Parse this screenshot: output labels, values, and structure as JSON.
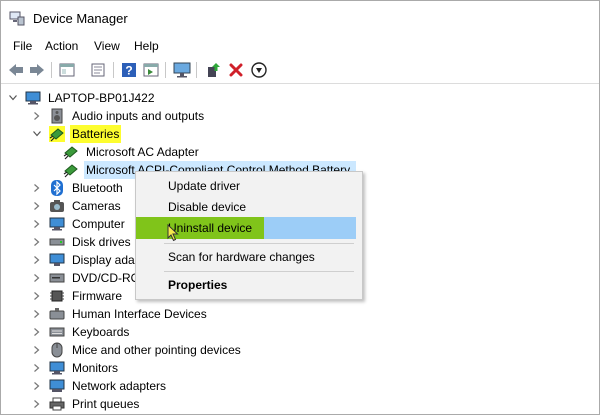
{
  "window": {
    "title": "Device Manager"
  },
  "menu": [
    "File",
    "Action",
    "View",
    "Help"
  ],
  "toolbar": [
    "back-icon",
    "forward-icon",
    "properties-icon",
    "update-icon",
    "help-icon",
    "view-icon",
    "monitor-icon",
    "update-driver-icon",
    "uninstall-icon",
    "download-icon"
  ],
  "tree": {
    "root": "LAPTOP-BP01J422",
    "items": [
      {
        "label": "Audio inputs and outputs"
      },
      {
        "label": "Batteries"
      },
      {
        "label": "Microsoft AC Adapter"
      },
      {
        "label": "Microsoft ACPI-Compliant Control Method Battery"
      },
      {
        "label": "Bluetooth"
      },
      {
        "label": "Cameras"
      },
      {
        "label": "Computer"
      },
      {
        "label": "Disk drives"
      },
      {
        "label": "Display adapters"
      },
      {
        "label": "DVD/CD-ROM drives"
      },
      {
        "label": "Firmware"
      },
      {
        "label": "Human Interface Devices"
      },
      {
        "label": "Keyboards"
      },
      {
        "label": "Mice and other pointing devices"
      },
      {
        "label": "Monitors"
      },
      {
        "label": "Network adapters"
      },
      {
        "label": "Print queues"
      }
    ]
  },
  "context_menu": {
    "update": "Update driver",
    "disable": "Disable device",
    "uninstall": "Uninstall device",
    "scan": "Scan for hardware changes",
    "properties": "Properties"
  },
  "colors": {
    "highlight_yellow": "#fdfd2f",
    "selection": "#cce8ff",
    "menu_hover": "#9ccdf7",
    "menu_green": "#80c41a"
  }
}
